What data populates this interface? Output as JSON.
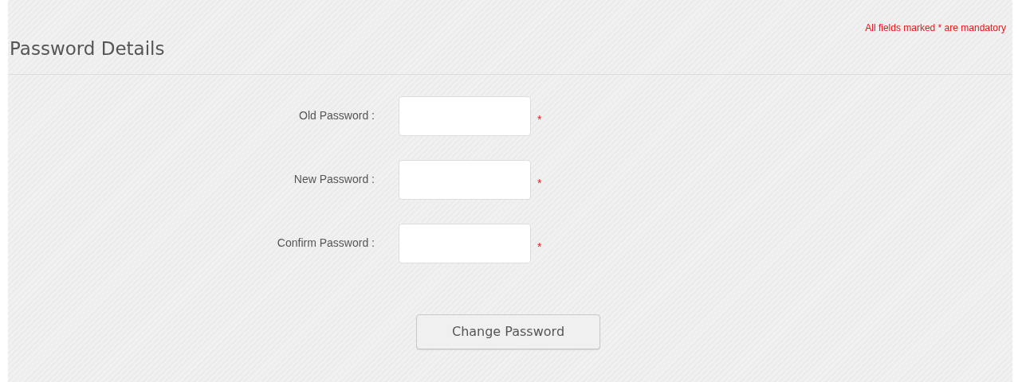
{
  "notice": "All fields marked * are mandatory",
  "title": "Password Details",
  "fields": [
    {
      "label": "Old Password :",
      "required": true,
      "mark": "*"
    },
    {
      "label": "New Password :",
      "required": true,
      "mark": "*"
    },
    {
      "label": "Confirm Password :",
      "required": true,
      "mark": "*"
    }
  ],
  "button": "Change Password"
}
